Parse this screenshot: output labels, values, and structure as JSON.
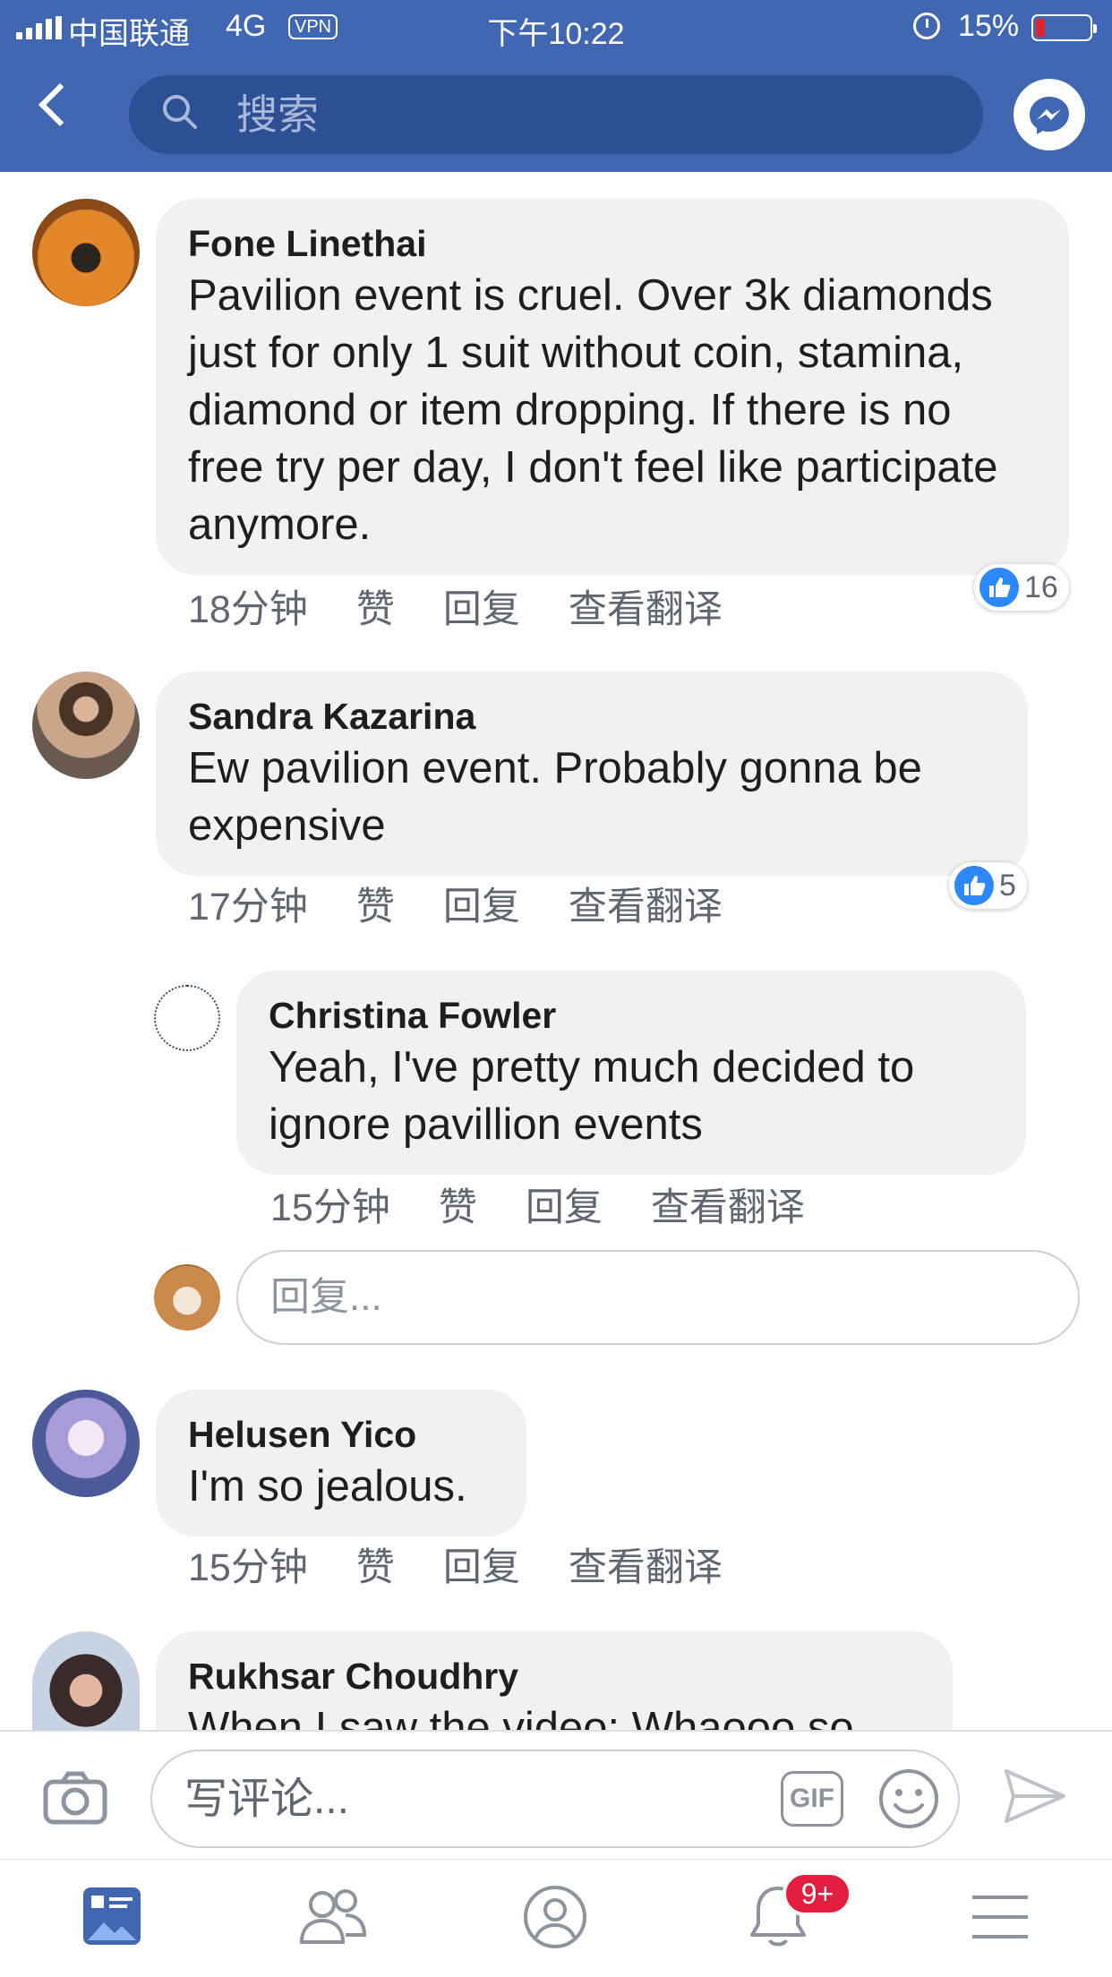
{
  "status_bar": {
    "carrier": "中国联通",
    "network": "4G",
    "vpn": "VPN",
    "time": "下午10:22",
    "battery_percent": "15%"
  },
  "header": {
    "search_placeholder": "搜索"
  },
  "comments": [
    {
      "author": "Fone Linethai",
      "text": "Pavilion event is cruel. Over 3k diamonds just for only 1 suit without coin, stamina, diamond or item dropping. If there is no free try per day, I don't feel like participate anymore.",
      "time": "18分钟",
      "like_label": "赞",
      "reply_label": "回复",
      "translate_label": "查看翻译",
      "likes": "16"
    },
    {
      "author": "Sandra Kazarina",
      "text": "Ew pavilion event. Probably gonna be expensive",
      "time": "17分钟",
      "like_label": "赞",
      "reply_label": "回复",
      "translate_label": "查看翻译",
      "likes": "5"
    },
    {
      "author": "Christina Fowler",
      "text": "Yeah, I've pretty much decided to ignore pavillion events",
      "time": "15分钟",
      "like_label": "赞",
      "reply_label": "回复",
      "translate_label": "查看翻译"
    },
    {
      "author": "Helusen Yico",
      "text": "I'm so jealous.",
      "time": "15分钟",
      "like_label": "赞",
      "reply_label": "回复",
      "translate_label": "查看翻译"
    },
    {
      "author": "Rukhsar Choudhry",
      "text": "When I saw the video: Whaooo so"
    }
  ],
  "reply_box": {
    "placeholder": "回复..."
  },
  "composer": {
    "placeholder": "写评论...",
    "gif_label": "GIF"
  },
  "tab_bar": {
    "notifications_badge": "9+"
  },
  "colors": {
    "header_blue": "#4267b2",
    "bubble_gray": "#eff1f3",
    "like_blue": "#2d88ff",
    "badge_red": "#e41e3f"
  }
}
